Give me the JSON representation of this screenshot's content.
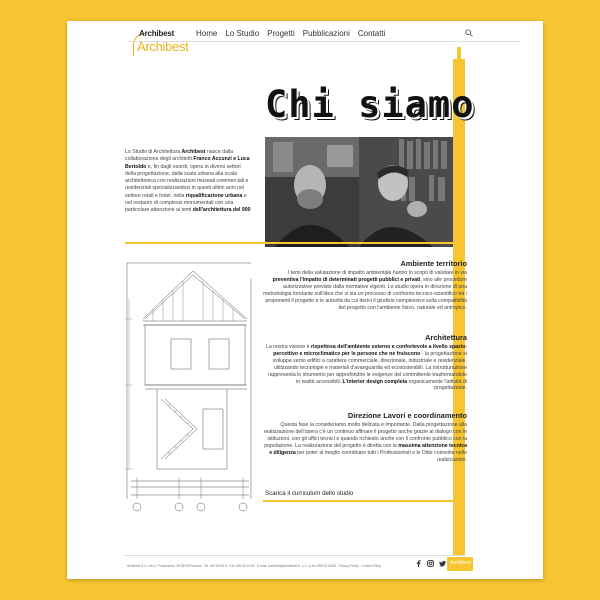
{
  "colors": {
    "accent": "#f7c531",
    "background": "#f7c531",
    "page": "#ffffff",
    "text": "#222222"
  },
  "logo": {
    "top": "Archibest",
    "main": "Archibest"
  },
  "nav": [
    "Home",
    "Lo Studio",
    "Progetti",
    "Pubblicazioni",
    "Contatti"
  ],
  "page_title": "Chi siamo",
  "intro": {
    "t1": "Lo Studio di Architettura ",
    "b1": "Archibest",
    "t2": " nasce dalla collaborazione degli architetti ",
    "b2": "Franco Accunzi e Luca Bertoldo",
    "t3": " e, fin dagli esordi, opera in diversi settori della progettazione, dalla scala urbana alla scala architettonica con realizzazioni museali commerciali e residenziali specializzandosi in questi ultimi anni nel settore retail e hotel, nella ",
    "b3": "riqualificazione urbana",
    "t4": " e nel restauro di complessi monumentali con una particolare attenzione ai temi ",
    "b4": "dell'architettura del 900"
  },
  "sections": [
    {
      "title": "Ambiente territorio",
      "t1": "I temi della valutazione di impatto ambientale hanno lo scopo di valutare in via ",
      "b1": "preventiva l'impatto di determinati progetti pubblici e privati",
      "t2": ", sino alle procedure autorizzative previste dalla normative vigenti. Lo studio opera in direzione di una metodologia fondante sull'idea che vi sia un processo di confronto tecnico-scientifico tra i proponenti il progetto e le autorità da cui derivi il giudizio complessivo sulla compatibilità del progetto con l'ambiente fisico, naturale ed antropico."
    },
    {
      "title": "Architettura",
      "t1": "La nostra visione è ",
      "b1": "rispettosa dell'ambiente esterno e confortevole a livello spazio-percettivo e microclimatico per le persone che ne fruiscono",
      "t2": " - la progettazione si sviluppa verso edifici a carattere commerciale, direzionale, industriale e residenziale, utilizzando tecnologie e materiali d'avanguardia ed ecosostenibili. La ristrutturazione rappresenta lo strumento per approfondire le esigenze del committente trasformandole in realtà accessibili. ",
      "b2": "L'interior design completa",
      "t3": " organicamente l'attività di progettazione."
    },
    {
      "title": "Direzione Lavori e coordinamento",
      "t1": "Questa fase la consideriamo molto delicata e importante. Dalla progettazione alla realizzazione dell'opera c'è un continuo affinare il progetto anche grazie al dialogo con le istituzioni, con gli uffici tecnici e quando richiesto anche con il confronto pubblico con la popolazione. La realizzazione del progetto è diretta con la ",
      "b1": "massima attenzione tecnica e diligenza",
      "t2": " per poter al meglio coordinare tutti i Professionisti e le Ditte coinvolte nelle realizzazioni."
    }
  ],
  "cv_link": "Scarica il curriculum dello studio",
  "footer": "Archibest S.r.l. via G. Prosdocimo, 28 35139 Padova - Tel. 049 65 20 8 - Fax 049 65 20 82 - E-mail: archibest@archibest.it - c.f. / p.iva 03873110283 - Privacy Policy - Cookie Policy",
  "footer_logo": "Archibest",
  "icons": {
    "search": "search-icon",
    "facebook": "facebook-icon",
    "instagram": "instagram-icon",
    "twitter": "twitter-icon"
  }
}
